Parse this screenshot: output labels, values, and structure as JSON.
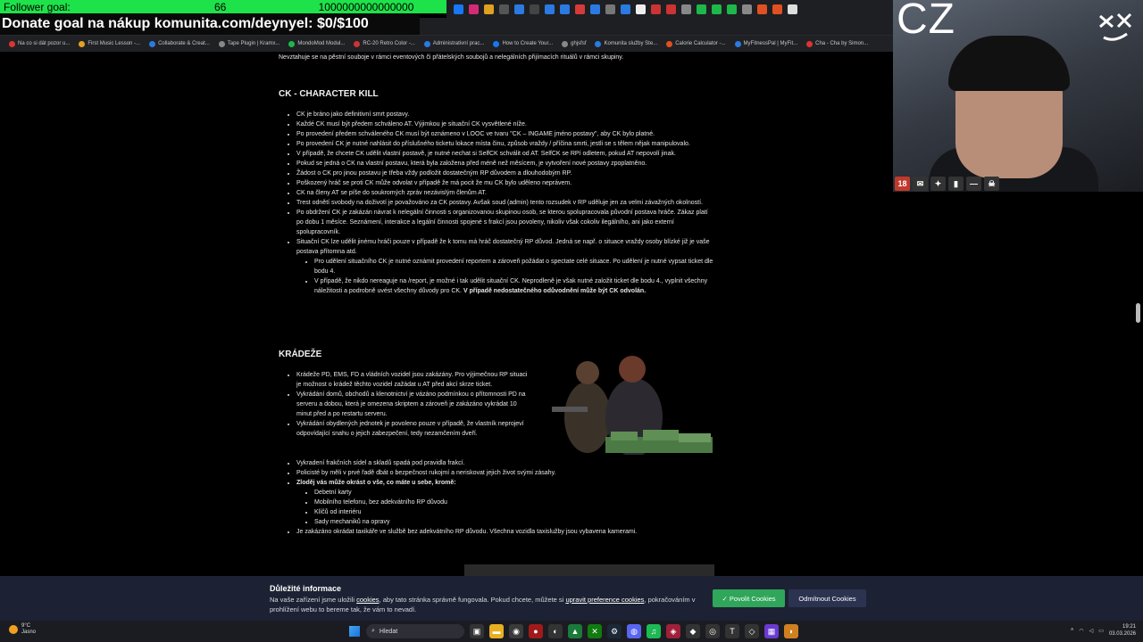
{
  "overlay": {
    "follower_label": "Follower goal:",
    "follower_count": "66",
    "follower_target": "1000000000000000",
    "donate_text": "Donate goal na nákup komunita.com/deynyel: $0/$100"
  },
  "bookmarks": [
    "Na co si dát pozor u...",
    "First Music Lesson -...",
    "Collaborate & Creat...",
    "Tape Plugin | Kramx...",
    "MondoMod Modul...",
    "RC-20 Retro Color -...",
    "Administrativní prac...",
    "How to Create Your...",
    "ghjsfsf",
    "Komunita služby Ste...",
    "Calorie Calculator -...",
    "MyFitnessPal | MyFit...",
    "Cha - Cha by Simon..."
  ],
  "webcam": {
    "overlay_text": "CZ",
    "badge_18": "18"
  },
  "page": {
    "top_line": "Nevztahuje se na pěstní souboje v rámci eventových či přátelských soubojů a nelegálních přijímacích rituálů v rámci skupiny.",
    "ck_heading": "CK - CHARACTER KILL",
    "ck_items": [
      "CK je bráno jako definitivní smrt postavy.",
      "Každé CK musí být předem schváleno AT. Výjimkou je situační CK vysvětlené níže.",
      "Po provedení předem schváleného CK musí být oznámeno v LOOC ve tvaru \"CK – INGAME jméno postavy\", aby CK bylo platné.",
      "Po provedení CK je nutné nahlásit do příslušného ticketu lokace místa činu, způsob vraždy / příčina smrti, jestli se s tělem nějak manipulovalo.",
      "V případě, že chcete CK udělit vlastní postavě, je nutné nechat si SelfCK schválit od AT. SelfCK se RPí odletem, pokud AT nepovolí jinak.",
      "Pokud se jedná o CK na vlastní postavu, která byla založena před méně než měsícem, je vytvoření nové postavy zpoplatněno.",
      "Žádost o CK pro jinou postavu je třeba vždy podložit dostatečným RP důvodem a dlouhodobým RP.",
      "Poškozený hráč se proti CK může odvolat v případě že má pocit že mu CK bylo uděleno neprávem.",
      "CK na členy AT se píše do soukromých zpráv nezávislým členům AT.",
      "Trest odnětí svobody na doživotí je považováno za CK postavy. Avšak soud (admin) tento rozsudek v RP uděluje jen za velmi závažných okolností.",
      "Po obdržení CK je zakázán návrat k nelegální činnosti s organizovanou skupinou osob, se kterou spolupracovala původní postava hráče. Zákaz platí po dobu 1 měsíce. Seznámení, interakce a legální činnosti spojené s frakcí jsou povoleny, nikoliv však cokoliv ilegálního, ani jako externí spolupracovník.",
      "Situační CK lze udělit jinému hráči pouze v případě že k tomu má hráč dostatečný RP důvod. Jedná se např. o situace vraždy osoby blízké již je vaše postava přítomna atd."
    ],
    "ck_sub_items": [
      "Pro udělení situačního CK je nutné oznámit provedení reportem a zároveň požádat o spectate celé situace. Po udělení je nutné vypsat ticket dle bodu 4.",
      "V případě, že nikdo nereaguje na /report, je možné i tak udělit situační CK. Neprodleně je však nutné založit ticket dle bodu 4., vyplnit všechny náležitosti a podrobně uvést všechny důvody pro CK.",
      "V případě nedostatečného odůvodnění může být CK odvolán."
    ],
    "theft_heading": "KRÁDEŽE",
    "theft_items": [
      "Krádeže PD, EMS, FD a vládních vozidel jsou zakázány. Pro výjimečnou RP situaci je možnost o krádež těchto vozidel zažádat u AT před akcí skrze ticket.",
      "Vykrádání domů, obchodů a klenotnictví je vázáno podmínkou o přítomnosti PD na serveru a dobou, která je omezena skriptem a zároveň je zakázáno vykrádat 10 minut před a po restartu serveru.",
      "Vykrádání obydlených jednotek je povoleno pouze v případě, že vlastník neprojeví odpovídající snahu o jejich zabezpečení, tedy nezamčením dveří.",
      "Vykradení frakčních sídel a skladů spadá pod pravidla frakcí.",
      "Policisté by měli v prvé řadě dbát o bezpečnost rukojmí a neriskovat jejich život svými zásahy."
    ],
    "theft_bold_item": "Zloděj vás může okrást o vše, co máte u sebe, kromě:",
    "theft_sub_items": [
      "Debetní karty",
      "Mobilního telefonu, bez adekvátního RP důvodu",
      "Klíčů od interiéru",
      "Sady mechaniků na opravy"
    ],
    "theft_last_item": "Je zakázáno okrádat taxikáře ve službě bez adekvátního RP důvodu. Všechna vozidla taxislužby jsou vybavena kamerami."
  },
  "cookie": {
    "title": "Důležité informace",
    "text_before": "Na vaše zařízení jsme uložili ",
    "link_cookies": "cookies",
    "text_middle": ", aby tato stránka správně fungovala. Pokud chcete, můžete si ",
    "link_prefs": "upravit preference cookies",
    "text_after": ", pokračováním v prohlížení webu to bereme tak, že vám to nevadí.",
    "accept_label": "✓ Povolit Cookies",
    "decline_label": "Odmítnout Cookies"
  },
  "taskbar": {
    "temp": "9°C",
    "weather": "Jasno",
    "search_placeholder": "Hledat",
    "time": "19:21",
    "date": "03.03.2026"
  }
}
